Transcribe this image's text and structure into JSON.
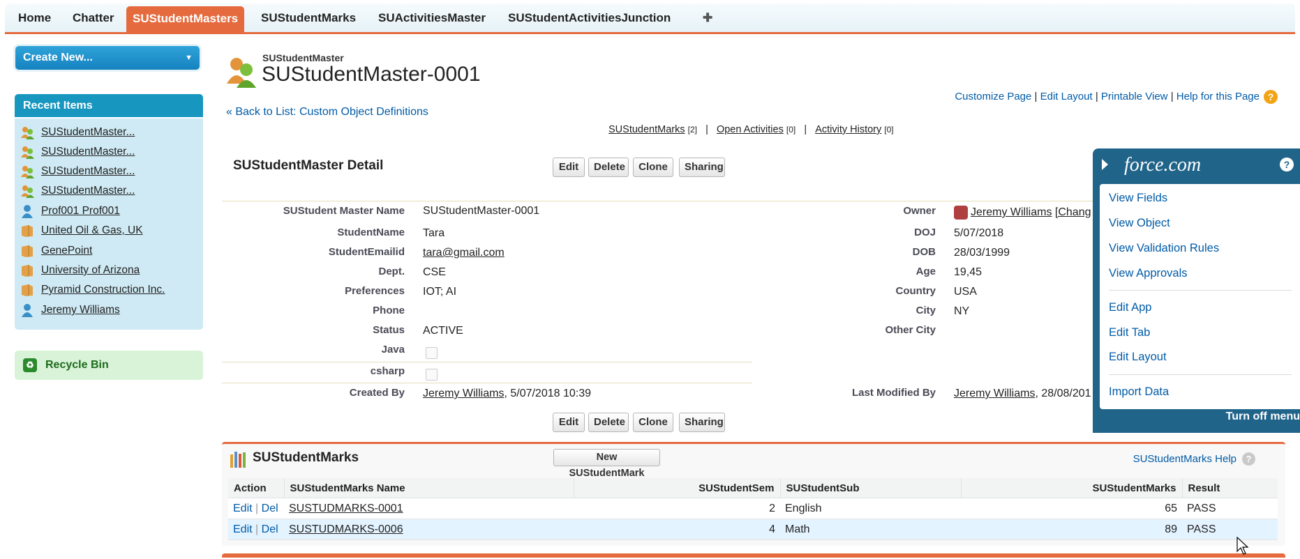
{
  "tabs": [
    "Home",
    "Chatter",
    "SUStudentMasters",
    "SUStudentMarks",
    "SUActivitiesMaster",
    "SUStudentActivitiesJunction",
    "✚"
  ],
  "sidebar": {
    "create_new": "Create New...",
    "recent_title": "Recent Items",
    "recent_items": [
      {
        "label": "SUStudentMaster...",
        "icon": "custom-object-icon"
      },
      {
        "label": "SUStudentMaster...",
        "icon": "custom-object-icon"
      },
      {
        "label": "SUStudentMaster...",
        "icon": "custom-object-icon"
      },
      {
        "label": "SUStudentMaster...",
        "icon": "custom-object-icon"
      },
      {
        "label": "Prof001 Prof001",
        "icon": "contact-icon"
      },
      {
        "label": "United Oil & Gas, UK",
        "icon": "account-icon"
      },
      {
        "label": "GenePoint",
        "icon": "account-icon"
      },
      {
        "label": "University of Arizona",
        "icon": "account-icon"
      },
      {
        "label": "Pyramid Construction Inc.",
        "icon": "account-icon"
      },
      {
        "label": "Jeremy Williams",
        "icon": "contact-icon"
      }
    ],
    "recycle_bin": "Recycle Bin"
  },
  "header": {
    "object_type": "SUStudentMaster",
    "record_name": "SUStudentMaster-0001",
    "links": [
      "Customize Page",
      "Edit Layout",
      "Printable View",
      "Help for this Page"
    ],
    "back_link": "« Back to List: Custom Object Definitions",
    "related_nav": [
      {
        "label": "SUStudentMarks",
        "count": "[2]"
      },
      {
        "label": "Open Activities",
        "count": "[0]"
      },
      {
        "label": "Activity History",
        "count": "[0]"
      }
    ]
  },
  "detail": {
    "title": "SUStudentMaster Detail",
    "buttons": [
      "Edit",
      "Delete",
      "Clone",
      "Sharing"
    ],
    "left": [
      {
        "label": "SUStudent Master Name",
        "value": "SUStudentMaster-0001"
      },
      {
        "label": "StudentName",
        "value": "Tara"
      },
      {
        "label": "StudentEmailid",
        "value": "tara@gmail.com"
      },
      {
        "label": "Dept.",
        "value": "CSE"
      },
      {
        "label": "Preferences",
        "value": "IOT; AI"
      },
      {
        "label": "Phone",
        "value": ""
      },
      {
        "label": "Status",
        "value": "ACTIVE"
      },
      {
        "label": "Java",
        "value": ""
      },
      {
        "label": "csharp",
        "value": ""
      }
    ],
    "right": [
      {
        "label": "Owner",
        "value": "Jeremy Williams",
        "extra": "[Chang"
      },
      {
        "label": "DOJ",
        "value": "5/07/2018"
      },
      {
        "label": "DOB",
        "value": "28/03/1999"
      },
      {
        "label": "Age",
        "value": "19,45"
      },
      {
        "label": "Country",
        "value": "USA"
      },
      {
        "label": "City",
        "value": "NY"
      },
      {
        "label": "Other City",
        "value": ""
      }
    ],
    "created_by": {
      "label": "Created By",
      "user": "Jeremy Williams",
      "date": ", 5/07/2018 10:39"
    },
    "modified_by": {
      "label": "Last Modified By",
      "user": "Jeremy Williams",
      "date": ", 28/08/201"
    }
  },
  "marks": {
    "title": "SUStudentMarks",
    "new_button": "New SUStudentMark",
    "help": "SUStudentMarks Help",
    "columns": [
      "Action",
      "SUStudentMarks Name",
      "SUStudentSem",
      "SUStudentSub",
      "SUStudentMarks",
      "Result"
    ],
    "rows": [
      {
        "edit": "Edit",
        "del": "Del",
        "name": "SUSTUDMARKS-0001",
        "sem": "2",
        "sub": "English",
        "marks": "65",
        "result": "PASS"
      },
      {
        "edit": "Edit",
        "del": "Del",
        "name": "SUSTUDMARKS-0006",
        "sem": "4",
        "sub": "Math",
        "marks": "89",
        "result": "PASS"
      }
    ]
  },
  "force_menu": {
    "logo": "force.com",
    "items_group1": [
      "View Fields",
      "View Object",
      "View Validation Rules",
      "View Approvals"
    ],
    "items_group2": [
      "Edit App",
      "Edit Tab",
      "Edit Layout"
    ],
    "items_group3": [
      "Import Data"
    ],
    "turn_off": "Turn off menu"
  },
  "colors": {
    "accent": "#e56a3e",
    "sidebar_blue": "#1797c0",
    "force_blue": "#20648a",
    "link": "#015ba7"
  }
}
